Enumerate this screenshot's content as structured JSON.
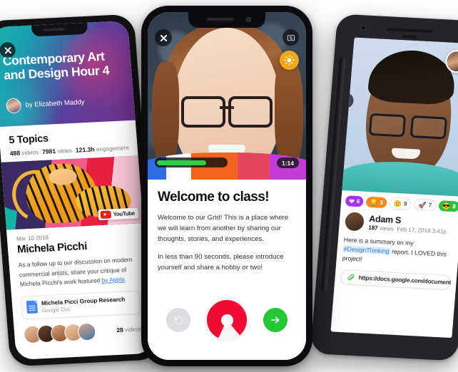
{
  "left_phone": {
    "close_icon": "close-icon",
    "hero": {
      "title": "Contemporary Art and Design Hour 4",
      "byline": "by Elizabeth Maddy",
      "avatar": "author-avatar"
    },
    "topics_heading": "5 Topics",
    "stats": {
      "videos_count": "488",
      "videos_label": "videos",
      "views_count": "7981",
      "views_label": "views",
      "engagement_count": "121.3h",
      "engagement_label": "engagement"
    },
    "artwork": {
      "badge_label": "YouTube",
      "badge_icon": "youtube-play-icon"
    },
    "post": {
      "date": "Mar 10 2018",
      "title": "Michela Picchi",
      "body_before_link": "As a follow up to our discussion on modern commercial artists, share your critique of Michela Picchi's work featured ",
      "body_link": "by Apple",
      "body_after_link": "."
    },
    "attachment": {
      "icon": "google-doc-icon",
      "title": "Michela Picci Group Research",
      "subtitle": "Google Doc"
    },
    "footer": {
      "videos_count": "28",
      "videos_label": "videos"
    }
  },
  "center_phone": {
    "close_icon": "close-icon",
    "flip_camera_icon": "camera-flip-icon",
    "brightness_icon": "sun-icon",
    "progress_percent": 72,
    "timer": "1:14",
    "heading": "Welcome to class!",
    "paragraph_1": "Welcome to our Grid! This is a place where we will learn from another by sharing our thoughts, stories, and experiences.",
    "paragraph_2": "In less than 90 seconds, please introduce yourself and share a hobby or two!",
    "controls": {
      "undo_icon": "undo-icon",
      "record_icon": "record-button",
      "next_icon": "arrow-right-icon"
    }
  },
  "right_phone": {
    "close_icon": "close-icon",
    "viewer_avatar": "viewer-avatar",
    "reactions": [
      {
        "icon": "heart-icon",
        "count": "6",
        "style": "purple"
      },
      {
        "icon": "lightbulb-icon",
        "count": "3",
        "style": "orange"
      },
      {
        "icon": "thinking-face-icon",
        "count": "9",
        "style": "white"
      },
      {
        "icon": "rocket-icon",
        "count": "7",
        "style": "white"
      },
      {
        "icon": "sunglasses-face-icon",
        "count": "8",
        "style": "green"
      }
    ],
    "more_icon": "more-options-icon",
    "user": {
      "name": "Adam S",
      "views_count": "187",
      "views_label": "views",
      "timestamp": "Feb 17, 2018 3:41p"
    },
    "caption_before_tag": "Here is a summary on my ",
    "caption_tag": "#DesignThinking",
    "caption_after_tag": " report. I LOVED this project!",
    "link": {
      "icon": "paperclip-icon",
      "url": "https://docs.google.com/document"
    }
  },
  "colors": {
    "record_red": "#ef0d33",
    "next_green": "#25c636",
    "progress_green": "#28d146",
    "sun_amber": "#f0a818",
    "link_blue": "#2f7fe0",
    "reaction_purple": "#a435f0",
    "reaction_orange": "#f5871f",
    "reaction_green": "#2fbf3f",
    "youtube_red": "#e62117"
  }
}
